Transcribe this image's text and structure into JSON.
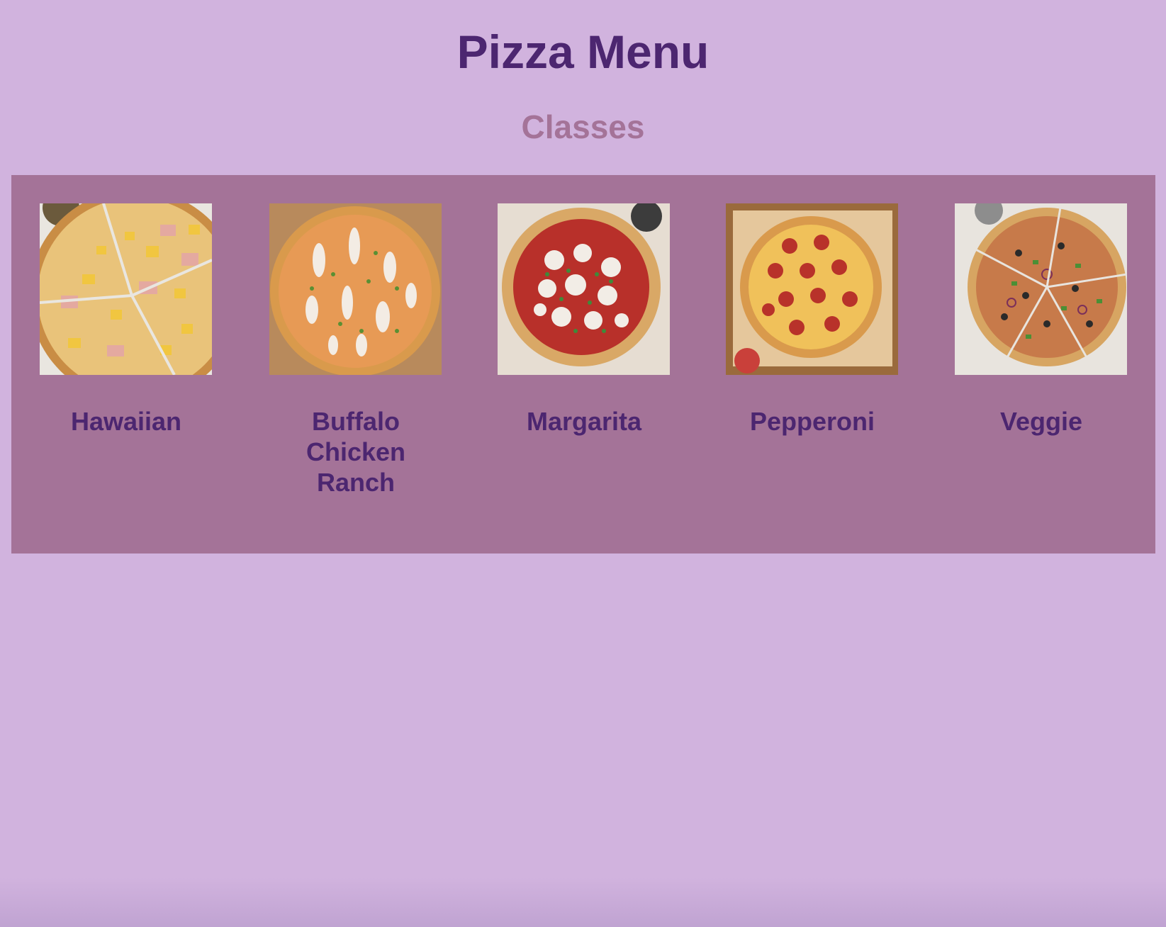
{
  "header": {
    "title": "Pizza Menu",
    "subtitle": "Classes"
  },
  "colors": {
    "background": "#d1b3de",
    "panel": "#a47398",
    "title": "#4c2670",
    "subtitle": "#a47398"
  },
  "menu": {
    "items": [
      {
        "name": "Hawaiian",
        "image": "hawaiian-pizza-photo"
      },
      {
        "name": "Buffalo Chicken Ranch",
        "image": "buffalo-chicken-ranch-pizza-photo"
      },
      {
        "name": "Margarita",
        "image": "margarita-pizza-photo"
      },
      {
        "name": "Pepperoni",
        "image": "pepperoni-pizza-photo"
      },
      {
        "name": "Veggie",
        "image": "veggie-pizza-photo"
      }
    ]
  }
}
